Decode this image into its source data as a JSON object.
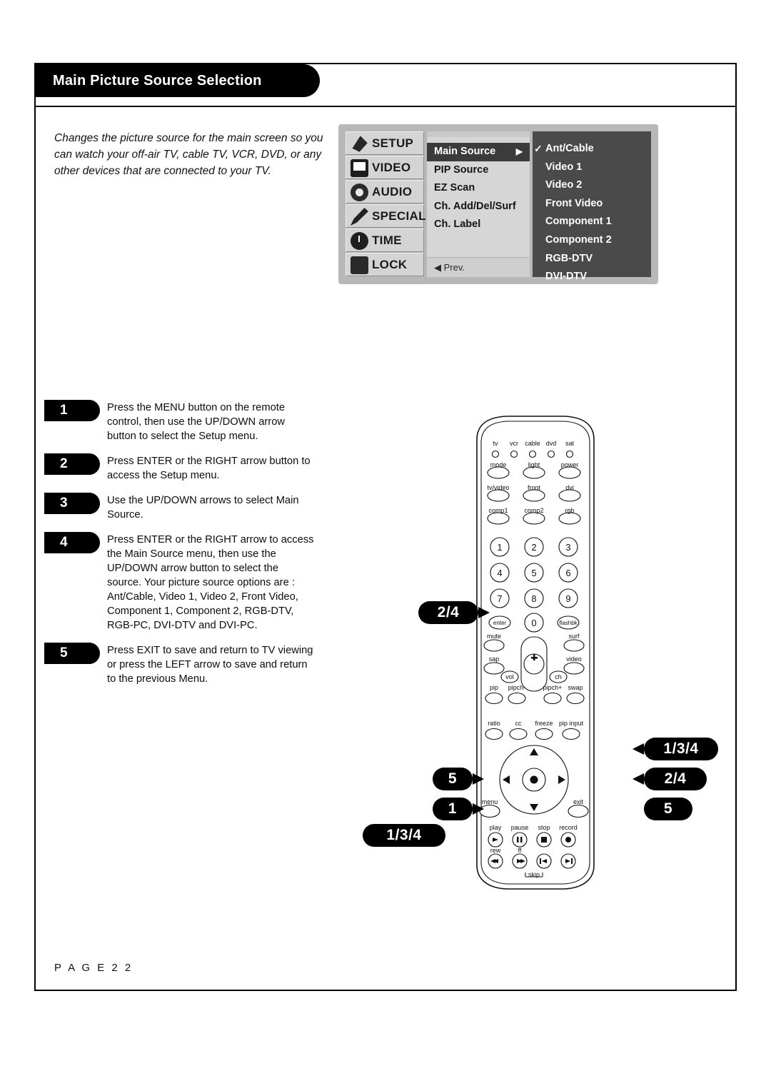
{
  "page": {
    "title": "Main Picture Source Selection",
    "intro": "Changes the picture source for the main screen so you can watch your off-air TV, cable TV, VCR, DVD, or any other devices that are connected to your TV.",
    "page_label": "P A G E  2 2"
  },
  "osd": {
    "categories": [
      {
        "label": "SETUP",
        "icon": "satellite-dish-icon"
      },
      {
        "label": "VIDEO",
        "icon": "tv-screen-icon"
      },
      {
        "label": "AUDIO",
        "icon": "speaker-icon"
      },
      {
        "label": "SPECIAL",
        "icon": "pencil-icon"
      },
      {
        "label": "TIME",
        "icon": "clock-icon"
      },
      {
        "label": "LOCK",
        "icon": "padlock-icon"
      }
    ],
    "menu_items": [
      {
        "label": "Main Source",
        "selected": true,
        "arrow": "▶"
      },
      {
        "label": "PIP Source",
        "selected": false,
        "arrow": ""
      },
      {
        "label": "EZ Scan",
        "selected": false,
        "arrow": ""
      },
      {
        "label": "Ch. Add/Del/Surf",
        "selected": false,
        "arrow": ""
      },
      {
        "label": "Ch. Label",
        "selected": false,
        "arrow": ""
      }
    ],
    "prev_label": "◀ Prev.",
    "sources": [
      {
        "label": "Ant/Cable",
        "checked": true,
        "check": "✓"
      },
      {
        "label": "Video 1",
        "checked": false,
        "check": ""
      },
      {
        "label": "Video 2",
        "checked": false,
        "check": ""
      },
      {
        "label": "Front Video",
        "checked": false,
        "check": ""
      },
      {
        "label": "Component 1",
        "checked": false,
        "check": ""
      },
      {
        "label": "Component 2",
        "checked": false,
        "check": ""
      },
      {
        "label": "RGB-DTV",
        "checked": false,
        "check": ""
      },
      {
        "label": "DVI-DTV",
        "checked": false,
        "check": ""
      }
    ]
  },
  "steps": [
    {
      "num": "1",
      "text": "Press the MENU button on the remote control, then use the UP/DOWN arrow button to select the Setup menu."
    },
    {
      "num": "2",
      "text": "Press ENTER or the RIGHT arrow button to access the Setup menu."
    },
    {
      "num": "3",
      "text": "Use the UP/DOWN arrows to select Main Source."
    },
    {
      "num": "4",
      "text": "Press ENTER or the RIGHT arrow to access the Main Source menu, then use the UP/DOWN arrow button to select the source. Your picture source options are : Ant/Cable, Video 1, Video 2, Front Video, Component 1, Component 2, RGB-DTV, RGB-PC, DVI-DTV and DVI-PC."
    },
    {
      "num": "5",
      "text": "Press EXIT to save and return to TV viewing or press the LEFT arrow to save and return to the previous Menu."
    }
  ],
  "callouts": {
    "enter": "2/4",
    "up_down_right": "1/3/4",
    "arrow_right": "2/4",
    "exit": "5",
    "menu_left": "1",
    "arrows_left": "1/3/4",
    "left_five": "5"
  },
  "remote": {
    "device_buttons": [
      "tv",
      "vcr",
      "cable",
      "dvd",
      "sat"
    ],
    "row_mode": [
      "mode",
      "light",
      "power"
    ],
    "row_input": [
      "tv/video",
      "front",
      "dvi"
    ],
    "row_comp": [
      "comp1",
      "comp2",
      "rgb"
    ],
    "keypad": [
      "1",
      "2",
      "3",
      "4",
      "5",
      "6",
      "7",
      "8",
      "9",
      "enter",
      "0",
      "flashbk"
    ],
    "mute_label": "mute",
    "surf_label": "surf",
    "sap_label": "sap",
    "video_label": "video",
    "vol_label": "vol",
    "ch_label": "ch",
    "plus_label": "+",
    "minus_label": "—",
    "pip_row": [
      "pip",
      "pipch-",
      "pipch+",
      "swap"
    ],
    "ratio_row": [
      "ratio",
      "cc",
      "freeze",
      "pip input"
    ],
    "menu_label": "menu",
    "exit_label": "exit",
    "transport_row": [
      "play",
      "pause",
      "stop",
      "record"
    ],
    "transport_row2": [
      "rew",
      "ff"
    ],
    "skip_label": "skip"
  }
}
